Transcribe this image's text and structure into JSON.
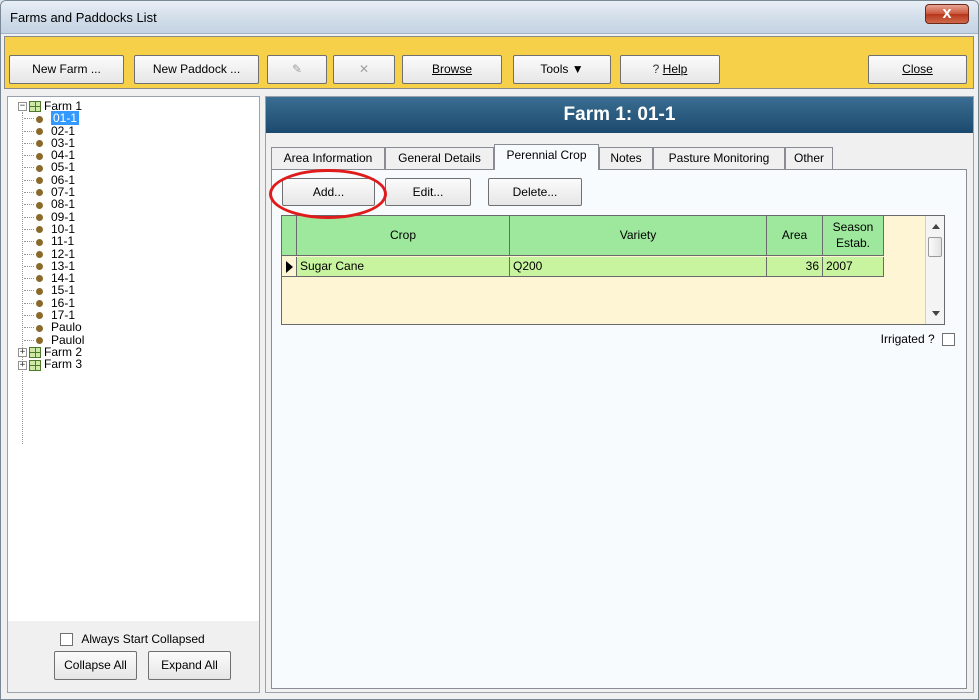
{
  "window": {
    "title": "Farms and Paddocks List",
    "close_glyph": "X"
  },
  "toolbar": {
    "new_farm": "New Farm ...",
    "new_paddock": "New Paddock ...",
    "browse": "Browse",
    "tools": "Tools ▼",
    "help": "Help",
    "close": "Close"
  },
  "tree": {
    "farms": [
      {
        "label": "Farm 1",
        "expanded": true,
        "paddocks": [
          "01-1",
          "02-1",
          "03-1",
          "04-1",
          "05-1",
          "06-1",
          "07-1",
          "08-1",
          "09-1",
          "10-1",
          "11-1",
          "12-1",
          "13-1",
          "14-1",
          "15-1",
          "16-1",
          "17-1",
          "Paulo",
          "Paulol"
        ],
        "selected": "01-1"
      },
      {
        "label": "Farm 2",
        "expanded": false
      },
      {
        "label": "Farm 3",
        "expanded": false
      }
    ],
    "always_collapsed_label": "Always Start Collapsed",
    "collapse_all": "Collapse All",
    "expand_all": "Expand All"
  },
  "main": {
    "header": "Farm 1: 01-1",
    "tabs": [
      "Area Information",
      "General Details",
      "Perennial Crop",
      "Notes",
      "Pasture Monitoring",
      "Other"
    ],
    "active_tab": "Perennial Crop",
    "buttons": {
      "add": "Add...",
      "edit": "Edit...",
      "delete": "Delete..."
    },
    "grid": {
      "columns": [
        "Crop",
        "Variety",
        "Area",
        "Season Estab."
      ],
      "rows": [
        {
          "crop": "Sugar Cane",
          "variety": "Q200",
          "area": "36",
          "season": "2007"
        }
      ]
    },
    "irrigated_label": "Irrigated ?"
  },
  "colors": {
    "toolbar": "#f7d04a",
    "header": "#1c4a6e",
    "grid_header": "#9de89d",
    "grid_row": "#c8f4a0",
    "highlight": "#e01b1b"
  }
}
